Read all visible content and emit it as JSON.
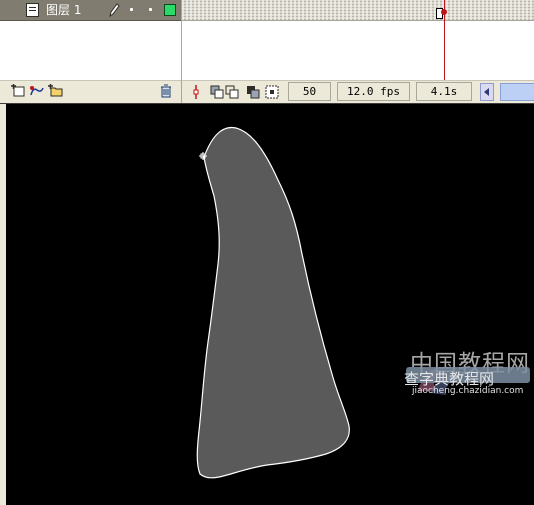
{
  "timeline": {
    "layer": {
      "name": "图层 1",
      "outline_color": "#2bd96b",
      "row_color": "#807d70"
    },
    "layer_toolbar": {
      "icons": [
        "insert-layer-icon",
        "add-motion-guide-icon",
        "insert-layer-folder-icon",
        "delete-layer-icon"
      ]
    },
    "playhead_color": "#c0151a",
    "status": {
      "current_frame": "50",
      "frame_rate": "12.0 fps",
      "elapsed_time": "4.1s"
    }
  },
  "stage": {
    "background": "#000000",
    "shape": {
      "fill": "#5a5a5a",
      "stroke": "#ffffff"
    }
  },
  "watermark": {
    "site_name": "中国教程网",
    "sub_text": "查字典教程网",
    "url": "jiaocheng.chazidian.com"
  }
}
